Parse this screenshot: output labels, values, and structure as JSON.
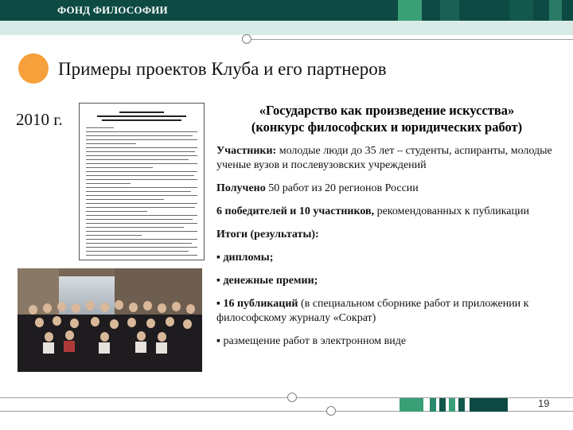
{
  "header": {
    "title": "ФОНД ФИЛОСОФИИ",
    "colors": {
      "band": "#0c4a43",
      "accent_square": "#3a9e77",
      "strip": "#d9ebe6"
    }
  },
  "slide": {
    "title": "Примеры проектов Клуба и его партнеров",
    "year": "2010 г.",
    "page_number": "19"
  },
  "competition": {
    "title_line1": "«Государство как произведение искусства»",
    "title_line2": "(конкурс философских и юридических работ)"
  },
  "details": {
    "participants_label": "Участники:",
    "participants_text": " молодые люди до 35 лет – студенты, аспиранты, молодые ученые вузов и послевузовских учреждений",
    "received_label": "Получено",
    "received_text": " 50 работ из 20 регионов России",
    "winners_label": "6 победителей и 10 участников,",
    "winners_text": " рекомендованных к публикации",
    "results_label": "Итоги (результаты):",
    "results": [
      {
        "bullet": "▪",
        "label": "дипломы;",
        "text": ""
      },
      {
        "bullet": "▪",
        "label": "денежные премии;",
        "text": ""
      },
      {
        "bullet": "▪",
        "label": "16 публикаций",
        "text": " (в специальном сборнике работ и приложении к философскому журналу «Сократ)"
      },
      {
        "bullet": "▪",
        "label": "",
        "text": "размещение работ в электронном виде"
      }
    ]
  },
  "accent_color": "#f5a03a"
}
